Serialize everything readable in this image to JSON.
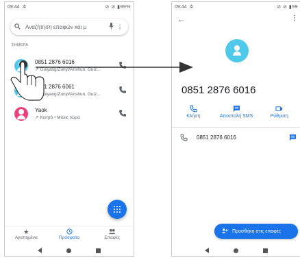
{
  "left_screen": {
    "status": {
      "time": "09:44",
      "right": "⊘ ⊘ ▮99%"
    },
    "search": {
      "placeholder": "Αναζήτηση επαφών και μ"
    },
    "section_label": "ΣΗΜΕΡΑ",
    "calls": [
      {
        "number": "0851 2876 6016",
        "detail": "Guiyang/Zunyi/Anshun, Guiz..."
      },
      {
        "number": "0851 2876 6061",
        "detail": "Guiyang/Zunyi/Anshun, Guiz..."
      },
      {
        "number": "Yaok",
        "detail": "Κινητό • Μόλις τώρα"
      }
    ],
    "bottom_nav": [
      {
        "label": "Αγαπημένα",
        "icon": "star-icon"
      },
      {
        "label": "Πρόσφατα",
        "icon": "clock-icon"
      },
      {
        "label": "Επαφές",
        "icon": "people-icon"
      }
    ]
  },
  "right_screen": {
    "status": {
      "time": "09:44",
      "right": "⊘ ⊘ ▮99"
    },
    "number": "0851 2876 6016",
    "actions": [
      {
        "label": "Κλήση",
        "icon": "phone-icon"
      },
      {
        "label": "Αποστολή SMS",
        "icon": "message-icon"
      },
      {
        "label": "Ρύθμιση",
        "icon": "video-icon"
      }
    ],
    "detail_number": "0851 2876 6016",
    "add_button": "Προσθήκη στις επαφές"
  },
  "colors": {
    "accent": "#1a73e8",
    "avatar_cyan": "#4ec9ea",
    "avatar_pink": "#ec407a"
  }
}
